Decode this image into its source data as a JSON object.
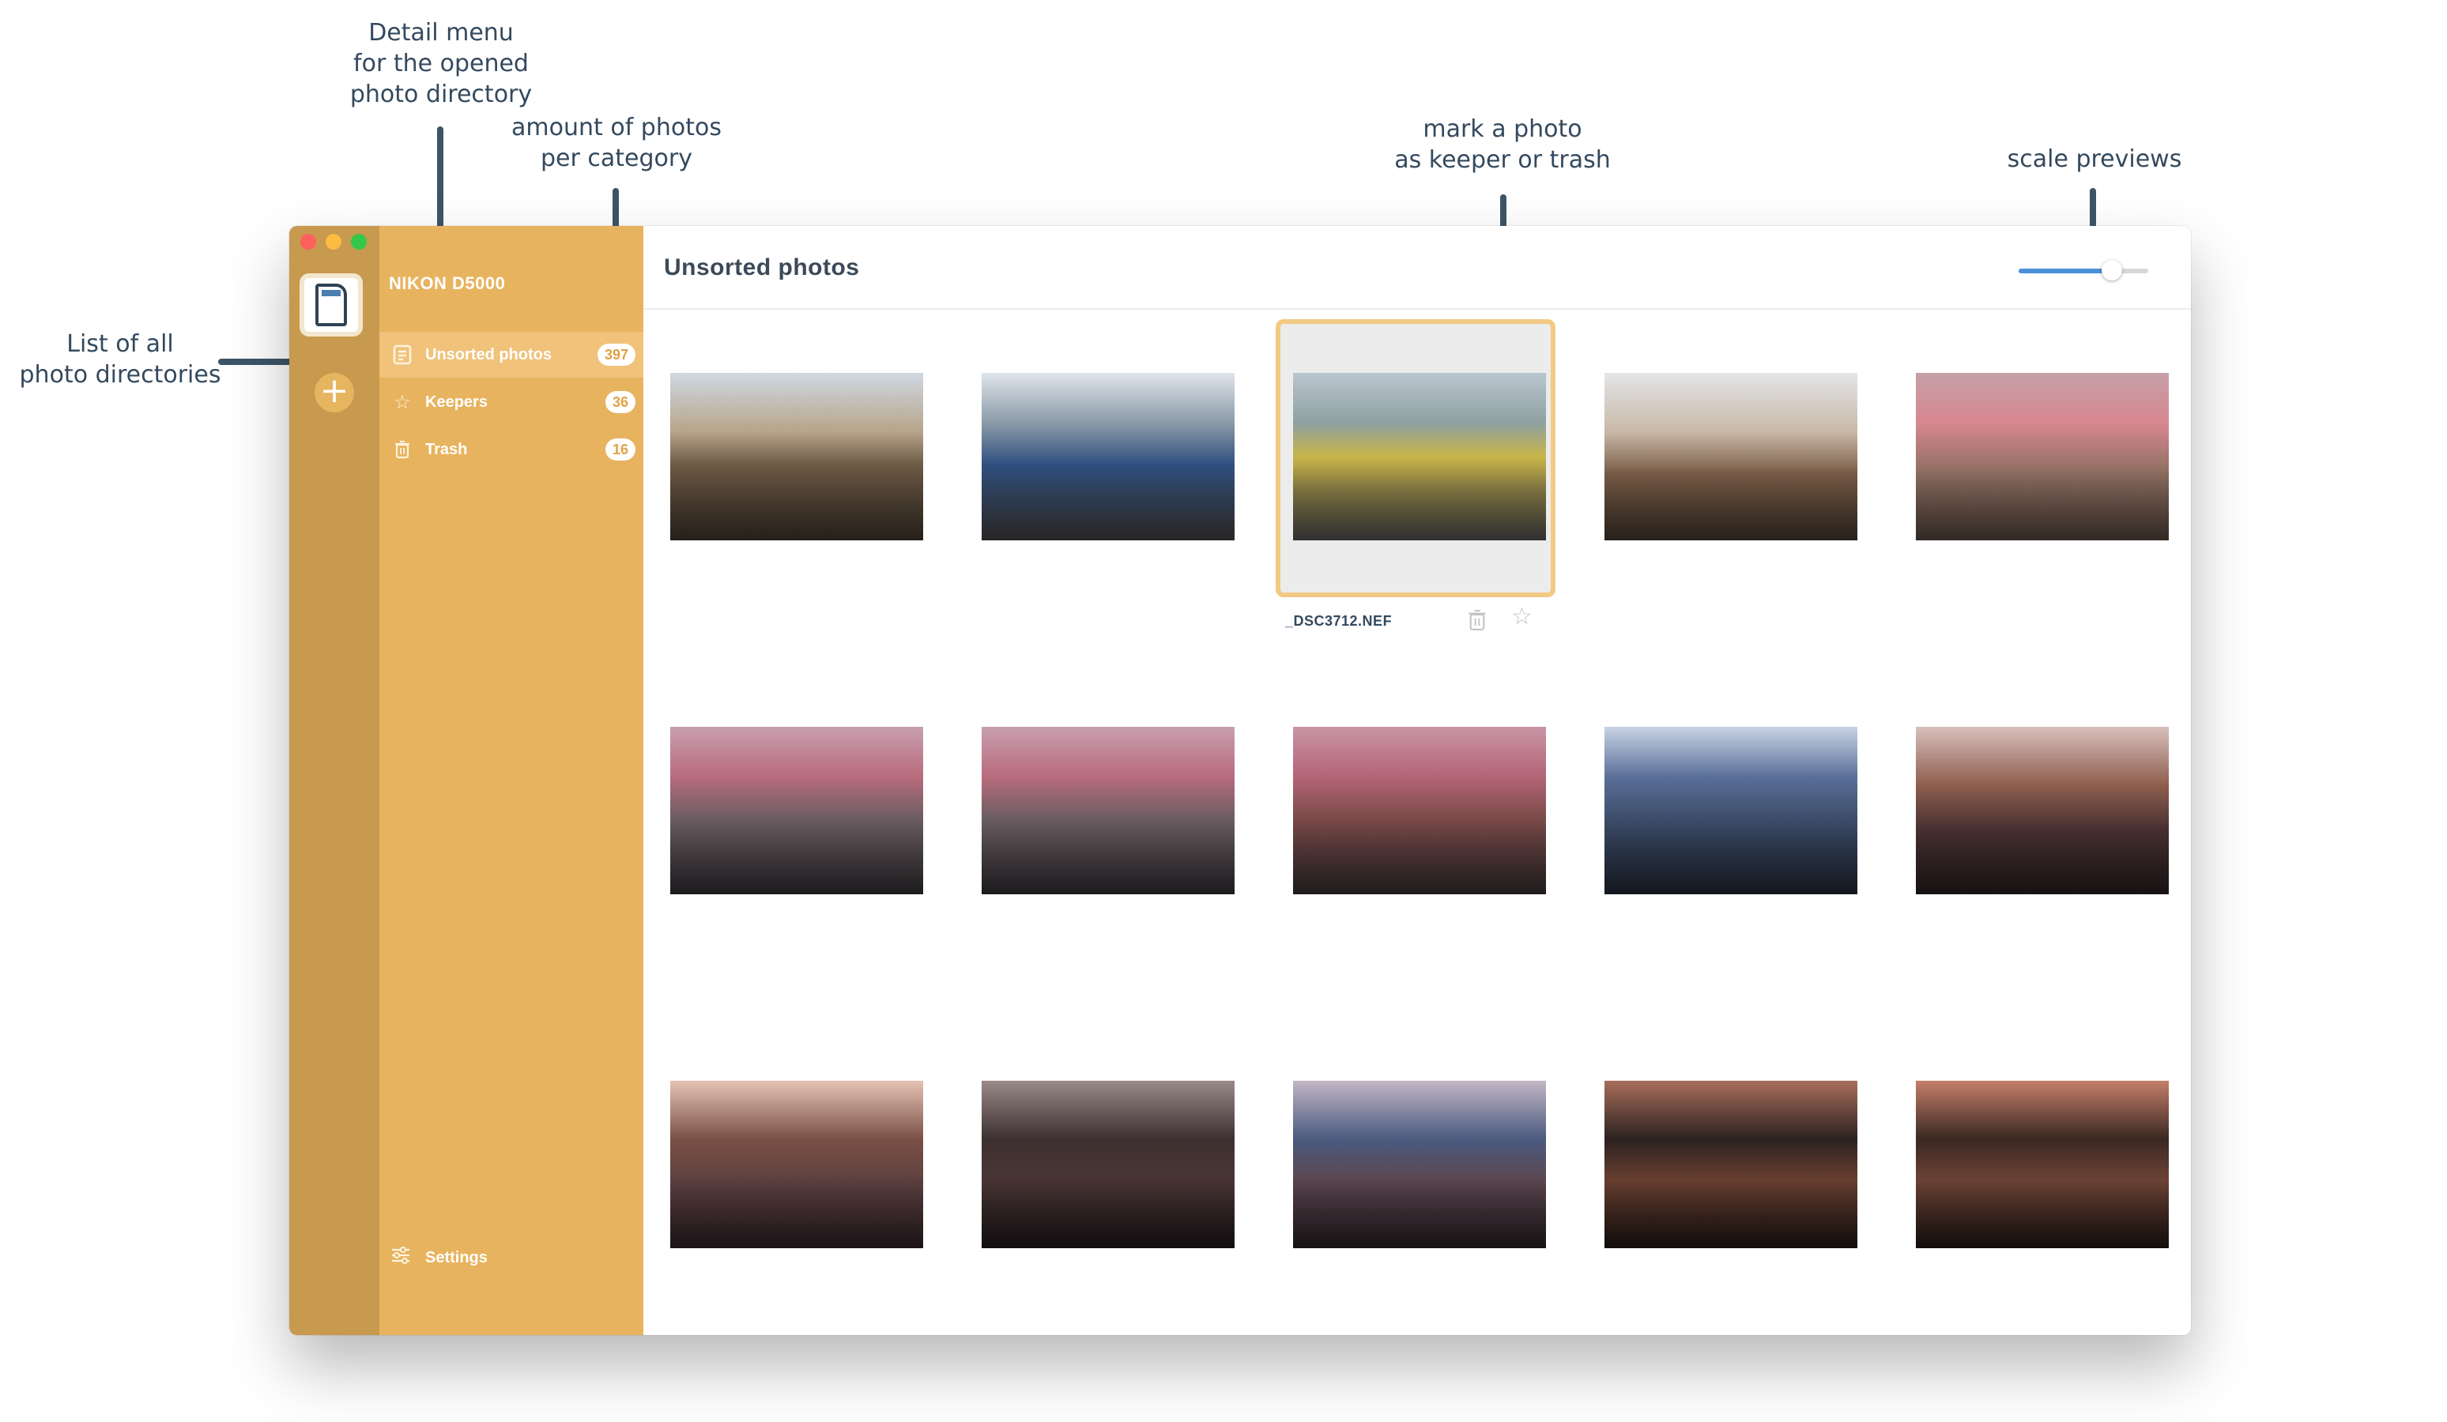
{
  "annotations": {
    "detail_menu": [
      "Detail menu",
      "for the opened",
      "photo directory"
    ],
    "amount": [
      "amount of photos",
      "per category"
    ],
    "mark": [
      "mark a photo",
      "as keeper or trash"
    ],
    "scale": [
      "scale previews"
    ],
    "list": [
      "List of all",
      "photo directories"
    ]
  },
  "window": {
    "directory_name": "NIKON D5000",
    "directory_icon": "sd-card-icon",
    "add_directory_icon": "plus-icon"
  },
  "categories": [
    {
      "label": "Unsorted photos",
      "count": "397",
      "icon": "list-icon",
      "active": true
    },
    {
      "label": "Keepers",
      "count": "36",
      "icon": "star-icon",
      "active": false
    },
    {
      "label": "Trash",
      "count": "16",
      "icon": "trash-icon",
      "active": false
    }
  ],
  "settings_label": "Settings",
  "main": {
    "title": "Unsorted photos",
    "scale_slider_value": 0.72
  },
  "selected_photo": {
    "filename": "_DSC3712.NEF",
    "trash_icon": "trash-icon",
    "keeper_icon": "star-icon"
  },
  "colors": {
    "directory_column": "#c79a4f",
    "sidebar": "#e8b35e",
    "sidebar_active": "#f0c27a",
    "selection_frame": "#f3ca84",
    "slider_accent": "#4a90d9"
  }
}
